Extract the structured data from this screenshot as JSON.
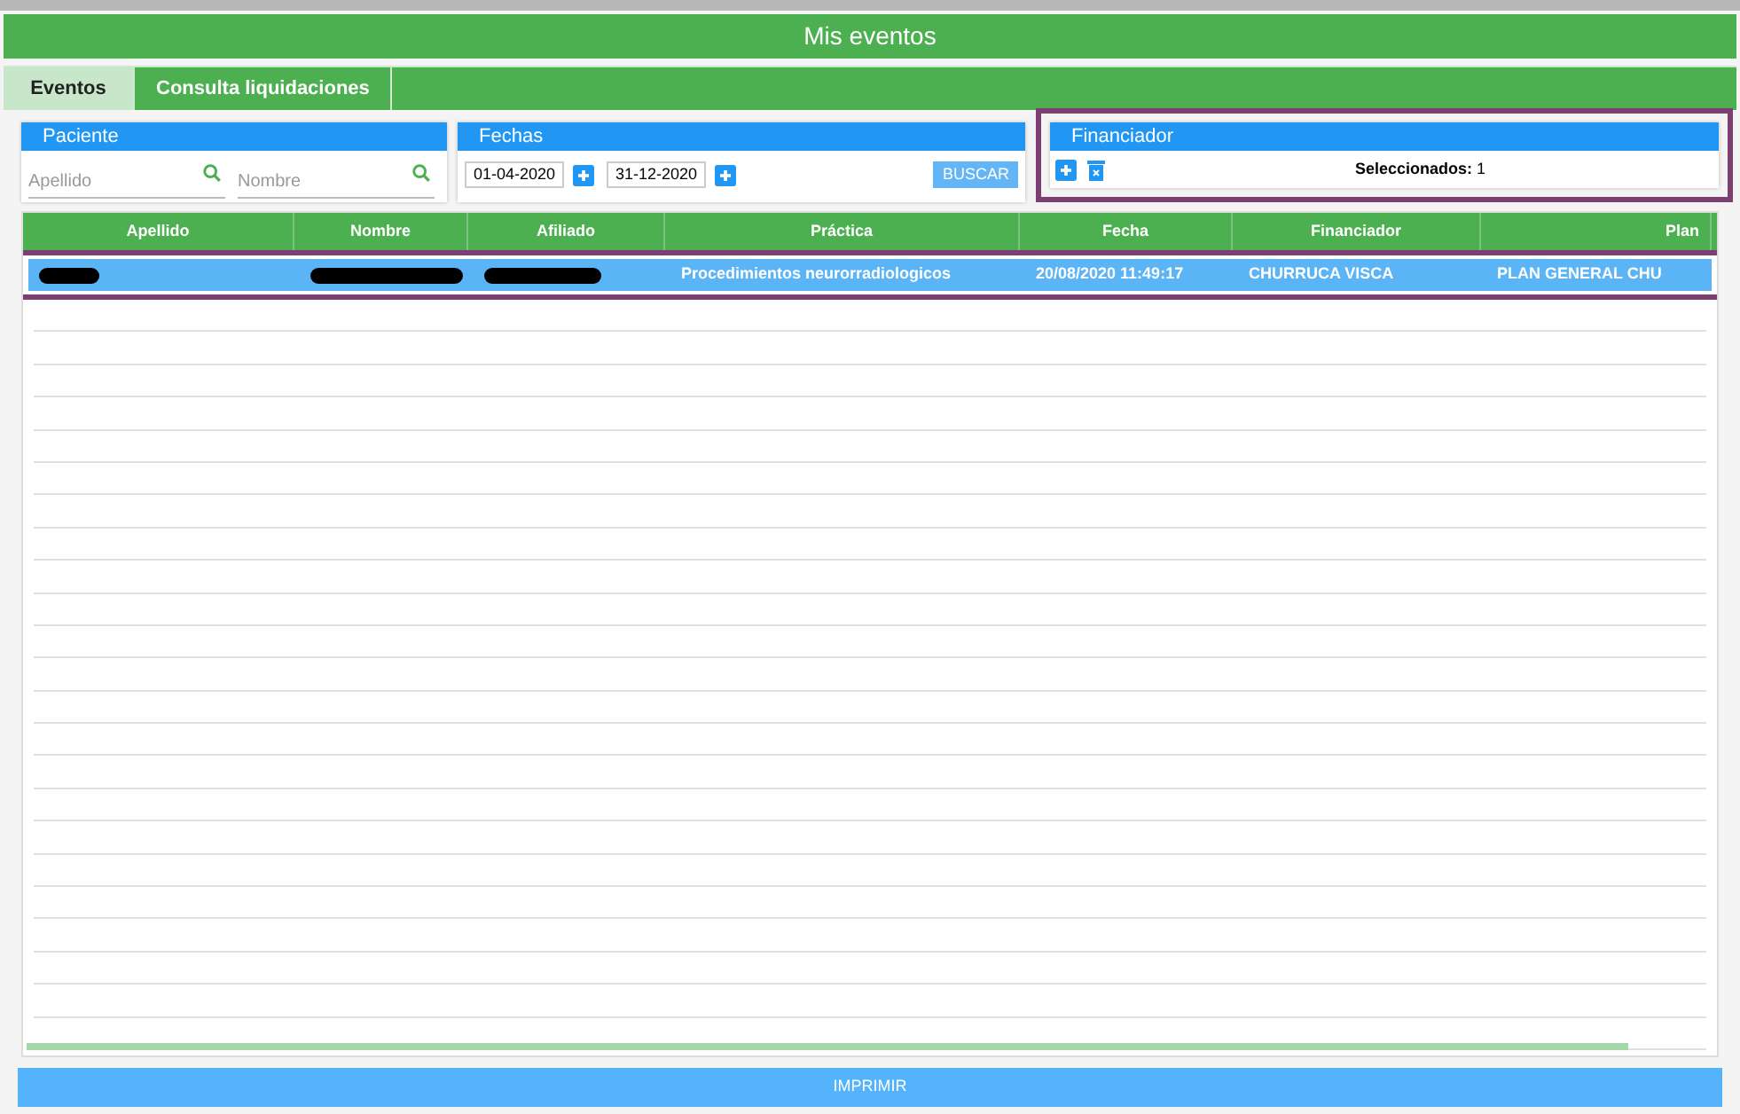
{
  "header": {
    "title": "Mis eventos"
  },
  "tabs": [
    {
      "label": "Eventos",
      "selected": true
    },
    {
      "label": "Consulta liquidaciones",
      "selected": false
    }
  ],
  "filters": {
    "paciente": {
      "title": "Paciente",
      "apellido": {
        "placeholder": "Apellido"
      },
      "nombre": {
        "placeholder": "Nombre"
      }
    },
    "fechas": {
      "title": "Fechas",
      "desde": "01-04-2020",
      "hasta": "31-12-2020",
      "search_button": "BUSCAR"
    },
    "financiador": {
      "title": "Financiador",
      "summary": "**Seleccionados:** 1",
      "highlighted": true
    }
  },
  "table": {
    "columns": [
      "Apellido",
      "Nombre",
      "Afiliado",
      "Práctica",
      "Fecha",
      "Financiador",
      "Plan"
    ],
    "rows": [
      {
        "selected": true,
        "highlighted": true,
        "cells": [
          {
            "kind": "redacted"
          },
          {
            "kind": "redacted"
          },
          {
            "kind": "redacted"
          },
          {
            "kind": "text",
            "text": "Procedimientos neurorradiologicos"
          },
          {
            "kind": "text",
            "text": "20/08/2020 11:49:17"
          },
          {
            "kind": "text",
            "text": "CHURRUCA VISCA"
          },
          {
            "kind": "text",
            "text": "PLAN GENERAL CHU"
          }
        ]
      }
    ]
  },
  "print_button": "IMPRIMIR"
}
